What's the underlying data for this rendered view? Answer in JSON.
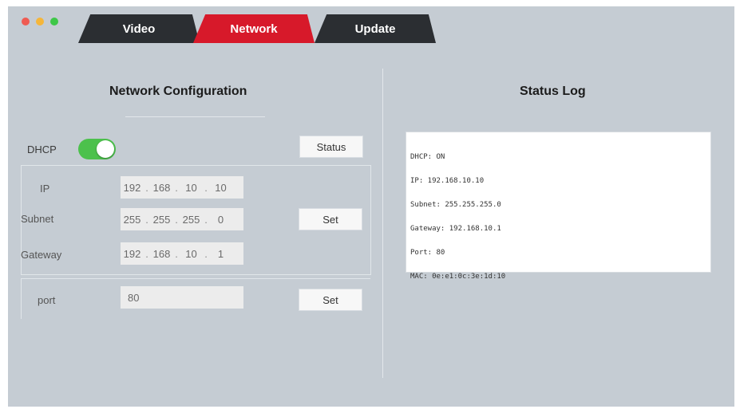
{
  "window": {
    "dots": [
      "red",
      "yellow",
      "green"
    ],
    "colors": {
      "red": "#ef5b52",
      "yellow": "#f5b63a",
      "green": "#3ec748"
    }
  },
  "tabs": [
    {
      "label": "Video",
      "active": false
    },
    {
      "label": "Network",
      "active": true
    },
    {
      "label": "Update",
      "active": false
    }
  ],
  "colors": {
    "active_tab": "#d7192a",
    "inactive_tab": "#2b2e32",
    "toggle_on": "#4cc14c",
    "background": "#c5ccd3"
  },
  "network": {
    "title": "Network Configuration",
    "dhcp": {
      "label": "DHCP",
      "enabled": true
    },
    "status_button": "Status",
    "ip": {
      "label": "IP",
      "octets": [
        "192",
        "168",
        "10",
        "10"
      ]
    },
    "subnet": {
      "label": "Subnet",
      "octets": [
        "255",
        "255",
        "255",
        "0"
      ]
    },
    "gateway": {
      "label": "Gateway",
      "octets": [
        "192",
        "168",
        "10",
        "1"
      ]
    },
    "set_button": "Set",
    "port": {
      "label": "port",
      "value": "80"
    },
    "port_set_button": "Set"
  },
  "status": {
    "title": "Status Log",
    "lines": [
      "DHCP: ON",
      "IP: 192.168.10.10",
      "Subnet: 255.255.255.0",
      "Gateway: 192.168.10.1",
      "Port: 80",
      "MAC: 0e:e1:0c:3e:1d:10"
    ]
  }
}
